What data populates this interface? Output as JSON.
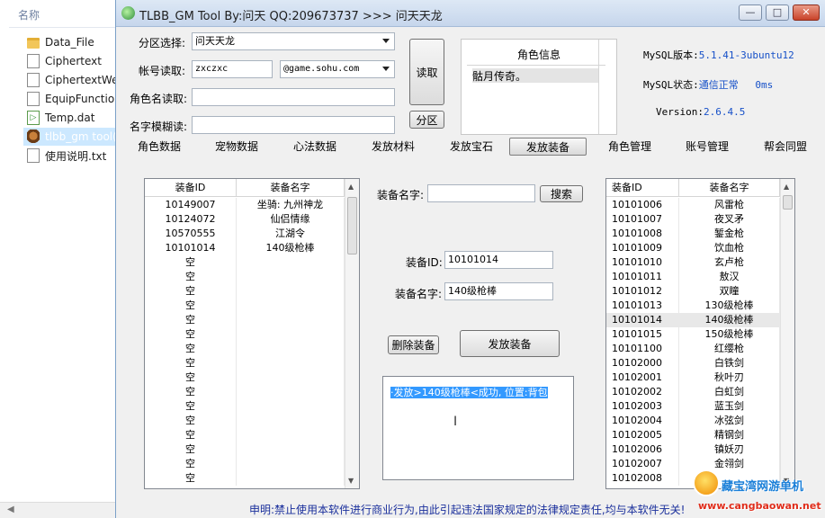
{
  "explorer": {
    "header": "名称",
    "files": [
      {
        "name": "Data_File",
        "icon": "folder-icon"
      },
      {
        "name": "Ciphertext",
        "icon": "document-icon"
      },
      {
        "name": "CiphertextWe",
        "icon": "document-icon"
      },
      {
        "name": "EquipFunctior",
        "icon": "script-icon"
      },
      {
        "name": "Temp.dat",
        "icon": "media-icon"
      },
      {
        "name": "tlbb_gm tool(",
        "icon": "app-icon"
      },
      {
        "name": "使用说明.txt",
        "icon": "text-file-icon"
      }
    ]
  },
  "window": {
    "title": "TLBB_GM Tool By:问天 QQ:209673737 >>> 问天天龙",
    "controls": {
      "minimize": "—",
      "maximize": "□",
      "close": "✕"
    }
  },
  "form": {
    "server_label": "分区选择:",
    "server_value": "问天天龙",
    "account_label": "帐号读取:",
    "account_value": "zxczxc",
    "domain_value": "@game.sohu.com",
    "role_label": "角色名读取:",
    "role_value": "",
    "fuzzy_label": "名字模糊读:",
    "fuzzy_value": "",
    "read_button": "读取",
    "zone_button": "分区"
  },
  "role_info": {
    "header": "角色信息",
    "rows": [
      "骷月传奇。",
      "",
      "",
      ""
    ]
  },
  "mysql": {
    "version_label": "MySQL版本:",
    "version_value": "5.1.41-3ubuntu12",
    "status_label": "MySQL状态:",
    "status_value": "通信正常",
    "latency": "0ms",
    "app_version_label": "Version:",
    "app_version_value": "2.6.4.5"
  },
  "tabs": [
    "角色数据",
    "宠物数据",
    "心法数据",
    "发放材料",
    "发放宝石",
    "发放装备",
    "角色管理",
    "账号管理",
    "帮会同盟"
  ],
  "active_tab": "发放装备",
  "left_grid": {
    "columns": [
      "装备ID",
      "装备名字"
    ],
    "rows": [
      [
        "10149007",
        "坐骑: 九州神龙"
      ],
      [
        "10124072",
        "仙侣情缘"
      ],
      [
        "10570555",
        "江湖令"
      ],
      [
        "10101014",
        "140级枪棒"
      ],
      [
        "空",
        ""
      ],
      [
        "空",
        ""
      ],
      [
        "空",
        ""
      ],
      [
        "空",
        ""
      ],
      [
        "空",
        ""
      ],
      [
        "空",
        ""
      ],
      [
        "空",
        ""
      ],
      [
        "空",
        ""
      ],
      [
        "空",
        ""
      ],
      [
        "空",
        ""
      ],
      [
        "空",
        ""
      ],
      [
        "空",
        ""
      ],
      [
        "空",
        ""
      ],
      [
        "空",
        ""
      ],
      [
        "空",
        ""
      ],
      [
        "空",
        ""
      ]
    ]
  },
  "equip_form": {
    "search_label": "装备名字:",
    "search_value": "",
    "search_button": "搜索",
    "id_label": "装备ID:",
    "id_value": "10101014",
    "name_label": "装备名字:",
    "name_value": "140级枪棒",
    "delete_button": "删除装备",
    "issue_button": "发放装备"
  },
  "log": {
    "text": "·发放>140级枪棒<成功, 位置:背包"
  },
  "right_grid": {
    "columns": [
      "装备ID",
      "装备名字"
    ],
    "rows": [
      [
        "10101006",
        "风雷枪"
      ],
      [
        "10101007",
        "夜叉矛"
      ],
      [
        "10101008",
        "錾金枪"
      ],
      [
        "10101009",
        "饮血枪"
      ],
      [
        "10101010",
        "玄卢枪"
      ],
      [
        "10101011",
        "敖汉"
      ],
      [
        "10101012",
        "双瞳"
      ],
      [
        "10101013",
        "130级枪棒"
      ],
      [
        "10101014",
        "140级枪棒"
      ],
      [
        "10101015",
        "150级枪棒"
      ],
      [
        "10101100",
        "红缨枪"
      ],
      [
        "10102000",
        "白铁剑"
      ],
      [
        "10102001",
        "秋叶刃"
      ],
      [
        "10102002",
        "白虹剑"
      ],
      [
        "10102003",
        "蓝玉剑"
      ],
      [
        "10102004",
        "冰弦剑"
      ],
      [
        "10102005",
        "精钢剑"
      ],
      [
        "10102006",
        "镇妖刃"
      ],
      [
        "10102007",
        "金翎剑"
      ],
      [
        "10102008",
        ""
      ]
    ],
    "highlighted_row": 8
  },
  "disclaimer": "申明:禁止使用本软件进行商业行为,由此引起违法国家规定的法律规定责任,均与本软件无关!",
  "watermark": {
    "line1": "藏宝湾网游单机",
    "line2": "www.cangbaowan.net"
  }
}
